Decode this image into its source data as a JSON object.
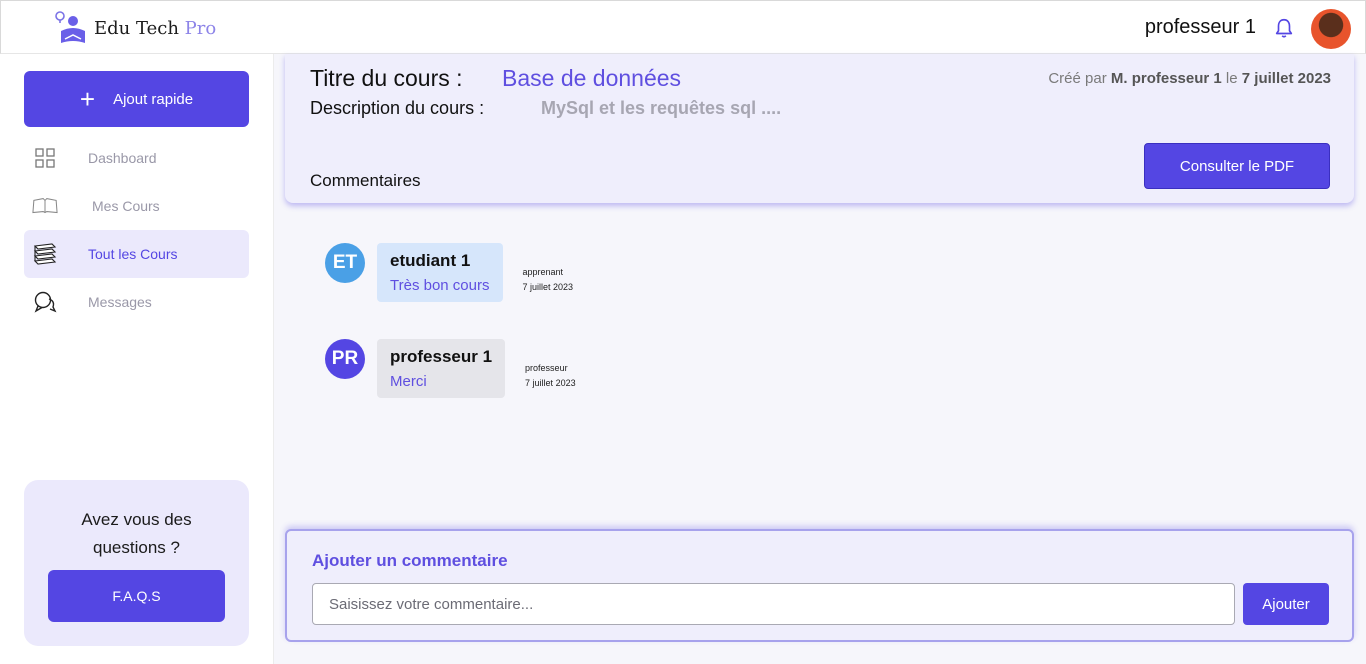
{
  "header": {
    "brand_name": "Edu Tech",
    "brand_suffix": "Pro",
    "user_name": "professeur 1",
    "icons": [
      "logo-icon",
      "bell-icon",
      "avatar"
    ]
  },
  "sidebar": {
    "quick_add_label": "Ajout rapide",
    "items": [
      {
        "label": "Dashboard",
        "icon": "grid-icon",
        "active": false
      },
      {
        "label": "Mes Cours",
        "icon": "open-book-icon",
        "active": false
      },
      {
        "label": "Tout les Cours",
        "icon": "books-stack-icon",
        "active": true
      },
      {
        "label": "Messages",
        "icon": "chat-bubbles-icon",
        "active": false
      }
    ],
    "faq_card": {
      "question": "Avez vous des questions ?",
      "button_label": "F.A.Q.S"
    }
  },
  "course": {
    "title_label": "Titre du cours :",
    "title_value": "Base de données",
    "description_label": "Description du cours :",
    "description_value": "MySql et les requêtes sql ....",
    "meta_prefix": "Créé par",
    "meta_author": "M. professeur 1",
    "meta_joiner": "le",
    "meta_date": "7 juillet 2023",
    "comments_heading": "Commentaires",
    "pdf_button_label": "Consulter le PDF"
  },
  "comments": [
    {
      "initials": "ET",
      "author": "etudiant 1",
      "text": "Très bon cours",
      "role": "apprenant",
      "date": "7 juillet 2023",
      "avatar_color": "#4aa0e6",
      "bubble_color": "#d6e6fb"
    },
    {
      "initials": "PR",
      "author": "professeur 1",
      "text": "Merci",
      "role": "professeur",
      "date": "7 juillet 2023",
      "avatar_color": "#5446e3",
      "bubble_color": "#e5e5ea"
    }
  ],
  "add_comment": {
    "title": "Ajouter un commentaire",
    "placeholder": "Saisissez votre commentaire...",
    "value": "",
    "button_label": "Ajouter"
  },
  "colors": {
    "accent": "#5446e3",
    "accent_light": "#ebe9fc"
  }
}
